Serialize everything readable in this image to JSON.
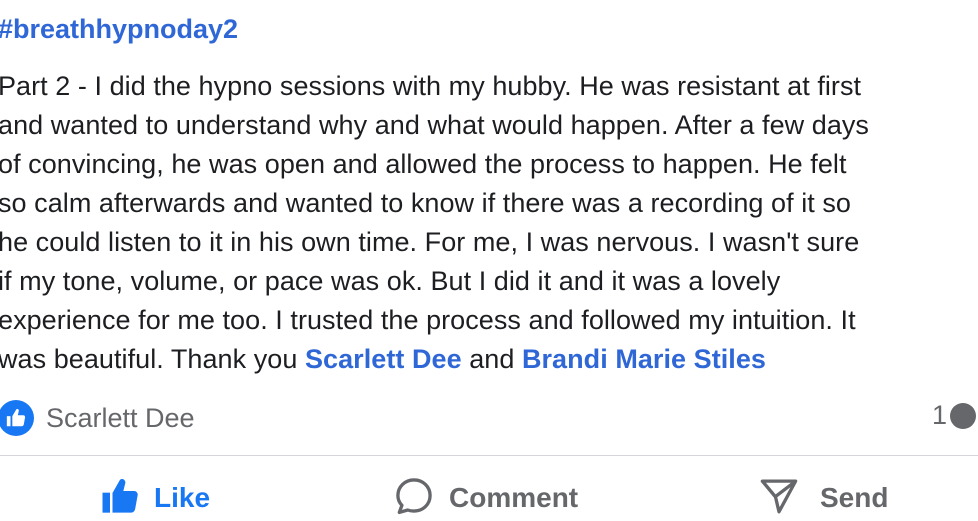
{
  "post": {
    "hashtag": "#breathhypnoday2",
    "lines": [
      "Part 2 - I did the hypno sessions with my hubby. He was resistant at first",
      "and wanted to understand why and what would happen. After a few days",
      "of convincing, he was open and allowed the process to happen. He felt",
      "so calm afterwards and wanted to know if there was a recording of it so",
      "he could listen to it in his own time. For me, I was nervous. I wasn't sure",
      "if my tone, volume, or pace was ok. But I did it and it was a lovely",
      "experience for me too. I trusted the process and followed my intuition. It"
    ],
    "last_line_prefix": "was beautiful. Thank you ",
    "mention_1": "Scarlett Dee",
    "last_line_joiner": " and ",
    "mention_2": "Brandi Marie Stiles"
  },
  "reactions": {
    "icon": "thumbs-up-icon",
    "name": "Scarlett Dee",
    "comment_count": "1"
  },
  "actions": {
    "like_label": "Like",
    "comment_label": "Comment",
    "send_label": "Send"
  },
  "colors": {
    "link_blue": "#2f67d6",
    "like_blue": "#1877f2",
    "text": "#1c1e21",
    "secondary_text": "#65676b",
    "divider": "#d4d6da"
  }
}
